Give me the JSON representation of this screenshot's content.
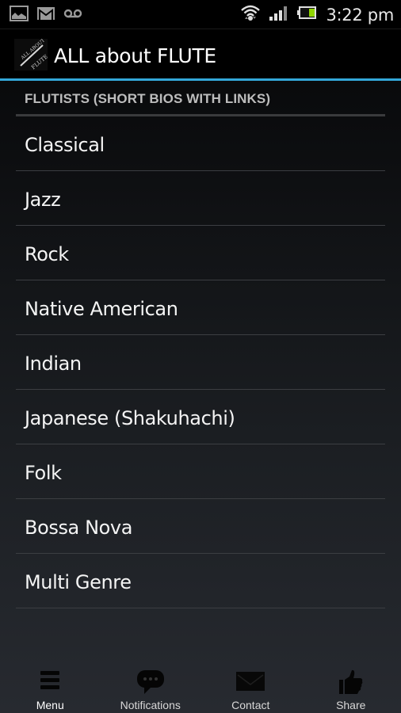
{
  "status_bar": {
    "left_icons": [
      "gallery-icon",
      "gmail-icon",
      "voicemail-icon"
    ],
    "right_icons": [
      "wifi-icon",
      "signal-icon",
      "battery-icon"
    ],
    "time": "3:22 pm"
  },
  "action_bar": {
    "logo": {
      "line1": "ALL ABOUT",
      "line2": "FLUTE"
    },
    "title": "ALL about FLUTE"
  },
  "section": {
    "header": "FLUTISTS (SHORT BIOS WITH LINKS)",
    "items": [
      {
        "label": "Classical"
      },
      {
        "label": "Jazz"
      },
      {
        "label": "Rock"
      },
      {
        "label": "Native American"
      },
      {
        "label": "Indian"
      },
      {
        "label": "Japanese (Shakuhachi)"
      },
      {
        "label": "Folk"
      },
      {
        "label": "Bossa Nova"
      },
      {
        "label": "Multi Genre"
      }
    ]
  },
  "bottom_nav": {
    "items": [
      {
        "label": "Menu",
        "icon": "menu-icon",
        "active": true
      },
      {
        "label": "Notifications",
        "icon": "chat-bubble-icon",
        "active": false
      },
      {
        "label": "Contact",
        "icon": "envelope-icon",
        "active": false
      },
      {
        "label": "Share",
        "icon": "thumbs-up-icon",
        "active": false
      }
    ]
  },
  "colors": {
    "accent": "#33a7d9",
    "battery": "#8fd400"
  }
}
